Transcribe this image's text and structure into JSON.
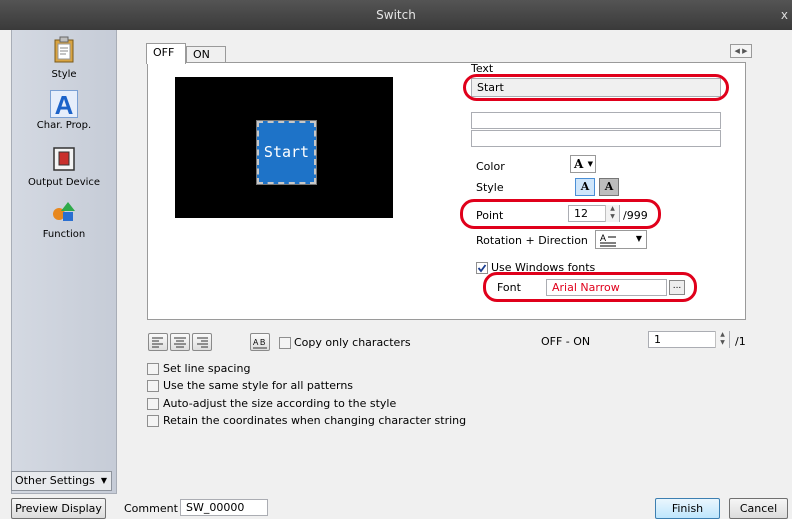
{
  "window": {
    "title": "Switch",
    "close": "x"
  },
  "sidebar": {
    "items": [
      {
        "label": "Style",
        "icon": "clipboard-icon"
      },
      {
        "label": "Char. Prop.",
        "icon": "letter-a-icon"
      },
      {
        "label": "Output Device",
        "icon": "output-device-icon"
      },
      {
        "label": "Function",
        "icon": "shapes-icon"
      }
    ],
    "other_settings": "Other Settings"
  },
  "tabs": {
    "off": "OFF",
    "on": "ON"
  },
  "preview": {
    "button_text": "Start",
    "button_color": "#1e73c8"
  },
  "text_section": {
    "label": "Text",
    "lines": [
      "Start",
      "",
      ""
    ],
    "color_label": "Color",
    "color_swatch": "A",
    "style_label": "Style",
    "style_btn1": "A",
    "style_btn2": "A",
    "point_label": "Point",
    "point_value": "12",
    "point_max": "/999",
    "rotation_label": "Rotation + Direction",
    "use_windows_fonts": "Use Windows fonts",
    "use_windows_fonts_checked": true,
    "font_label": "Font",
    "font_value": "Arial Narrow",
    "font_color": "#e0001b",
    "browse": "..."
  },
  "align": {
    "copy_only_characters": "Copy only characters"
  },
  "off_on": {
    "label": "OFF - ON",
    "value": "1",
    "max": "/1"
  },
  "options": [
    "Set line spacing",
    "Use the same style for all patterns",
    "Auto-adjust the size according to the style",
    "Retain the coordinates when changing character string"
  ],
  "footer": {
    "preview_display": "Preview Display",
    "comment_label": "Comment",
    "comment_value": "SW_00000",
    "finish": "Finish",
    "cancel": "Cancel"
  }
}
